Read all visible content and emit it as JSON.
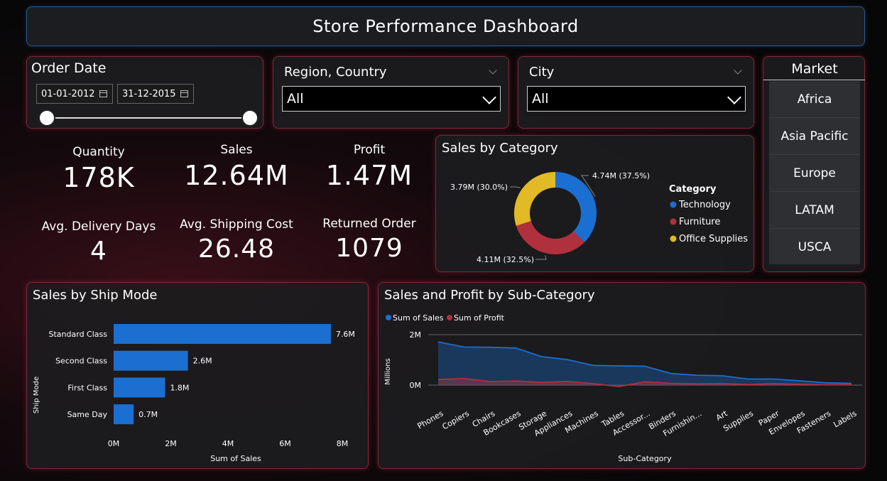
{
  "header": {
    "title": "Store Performance Dashboard"
  },
  "order_date": {
    "title": "Order Date",
    "start": "01-01-2012",
    "end": "31-12-2015"
  },
  "region_filter": {
    "title": "Region, Country",
    "value": "All"
  },
  "city_filter": {
    "title": "City",
    "value": "All"
  },
  "market": {
    "title": "Market",
    "items": [
      "Africa",
      "Asia Pacific",
      "Europe",
      "LATAM",
      "USCA"
    ]
  },
  "kpis": {
    "quantity": {
      "label": "Quantity",
      "value": "178K"
    },
    "sales": {
      "label": "Sales",
      "value": "12.64M"
    },
    "profit": {
      "label": "Profit",
      "value": "1.47M"
    },
    "delivery": {
      "label": "Avg. Delivery Days",
      "value": "4"
    },
    "shipping": {
      "label": "Avg. Shipping Cost",
      "value": "26.48"
    },
    "returned": {
      "label": "Returned Order",
      "value": "1079"
    }
  },
  "colors": {
    "technology": "#1a6fd1",
    "furniture": "#b0303e",
    "office": "#e2b926",
    "sales": "#1a6fd1",
    "profit": "#b0303e"
  },
  "chart_data": [
    {
      "type": "pie",
      "title": "Sales by Category",
      "legend_title": "Category",
      "legend_position": "right",
      "categories": [
        "Technology",
        "Furniture",
        "Office Supplies"
      ],
      "values": [
        4.74,
        4.11,
        3.79
      ],
      "labels": [
        "4.74M (37.5%)",
        "4.11M (32.5%)",
        "3.79M (30.0%)"
      ]
    },
    {
      "type": "bar",
      "title": "Sales by Ship Mode",
      "xlabel": "Sum of Sales",
      "ylabel": "Ship Mode",
      "categories": [
        "Standard Class",
        "Second Class",
        "First Class",
        "Same Day"
      ],
      "values": [
        7.6,
        2.6,
        1.8,
        0.7
      ],
      "labels": [
        "7.6M",
        "2.6M",
        "1.8M",
        "0.7M"
      ],
      "xlim": [
        0,
        8
      ],
      "xticks": [
        "0M",
        "2M",
        "4M",
        "6M",
        "8M"
      ]
    },
    {
      "type": "area",
      "title": "Sales and Profit by Sub-Category",
      "xlabel": "Sub-Category",
      "ylabel": "Millions",
      "legend_position": "top-left",
      "yticks": [
        "0M",
        "2M"
      ],
      "ylim": [
        -0.15,
        2.0
      ],
      "categories": [
        "Phones",
        "Copiers",
        "Chairs",
        "Bookcases",
        "Storage",
        "Appliances",
        "Machines",
        "Tables",
        "Accessor...",
        "Binders",
        "Furnishin...",
        "Art",
        "Supplies",
        "Paper",
        "Envelopes",
        "Fasteners",
        "Labels"
      ],
      "series": [
        {
          "name": "Sum of Sales",
          "values": [
            1.71,
            1.51,
            1.5,
            1.47,
            1.13,
            1.01,
            0.78,
            0.76,
            0.75,
            0.46,
            0.39,
            0.37,
            0.24,
            0.24,
            0.17,
            0.09,
            0.07
          ]
        },
        {
          "name": "Sum of Profit",
          "values": [
            0.22,
            0.26,
            0.14,
            0.16,
            0.11,
            0.14,
            0.06,
            -0.06,
            0.13,
            0.07,
            0.05,
            0.06,
            0.02,
            0.06,
            0.03,
            0.01,
            0.02
          ]
        }
      ]
    }
  ]
}
